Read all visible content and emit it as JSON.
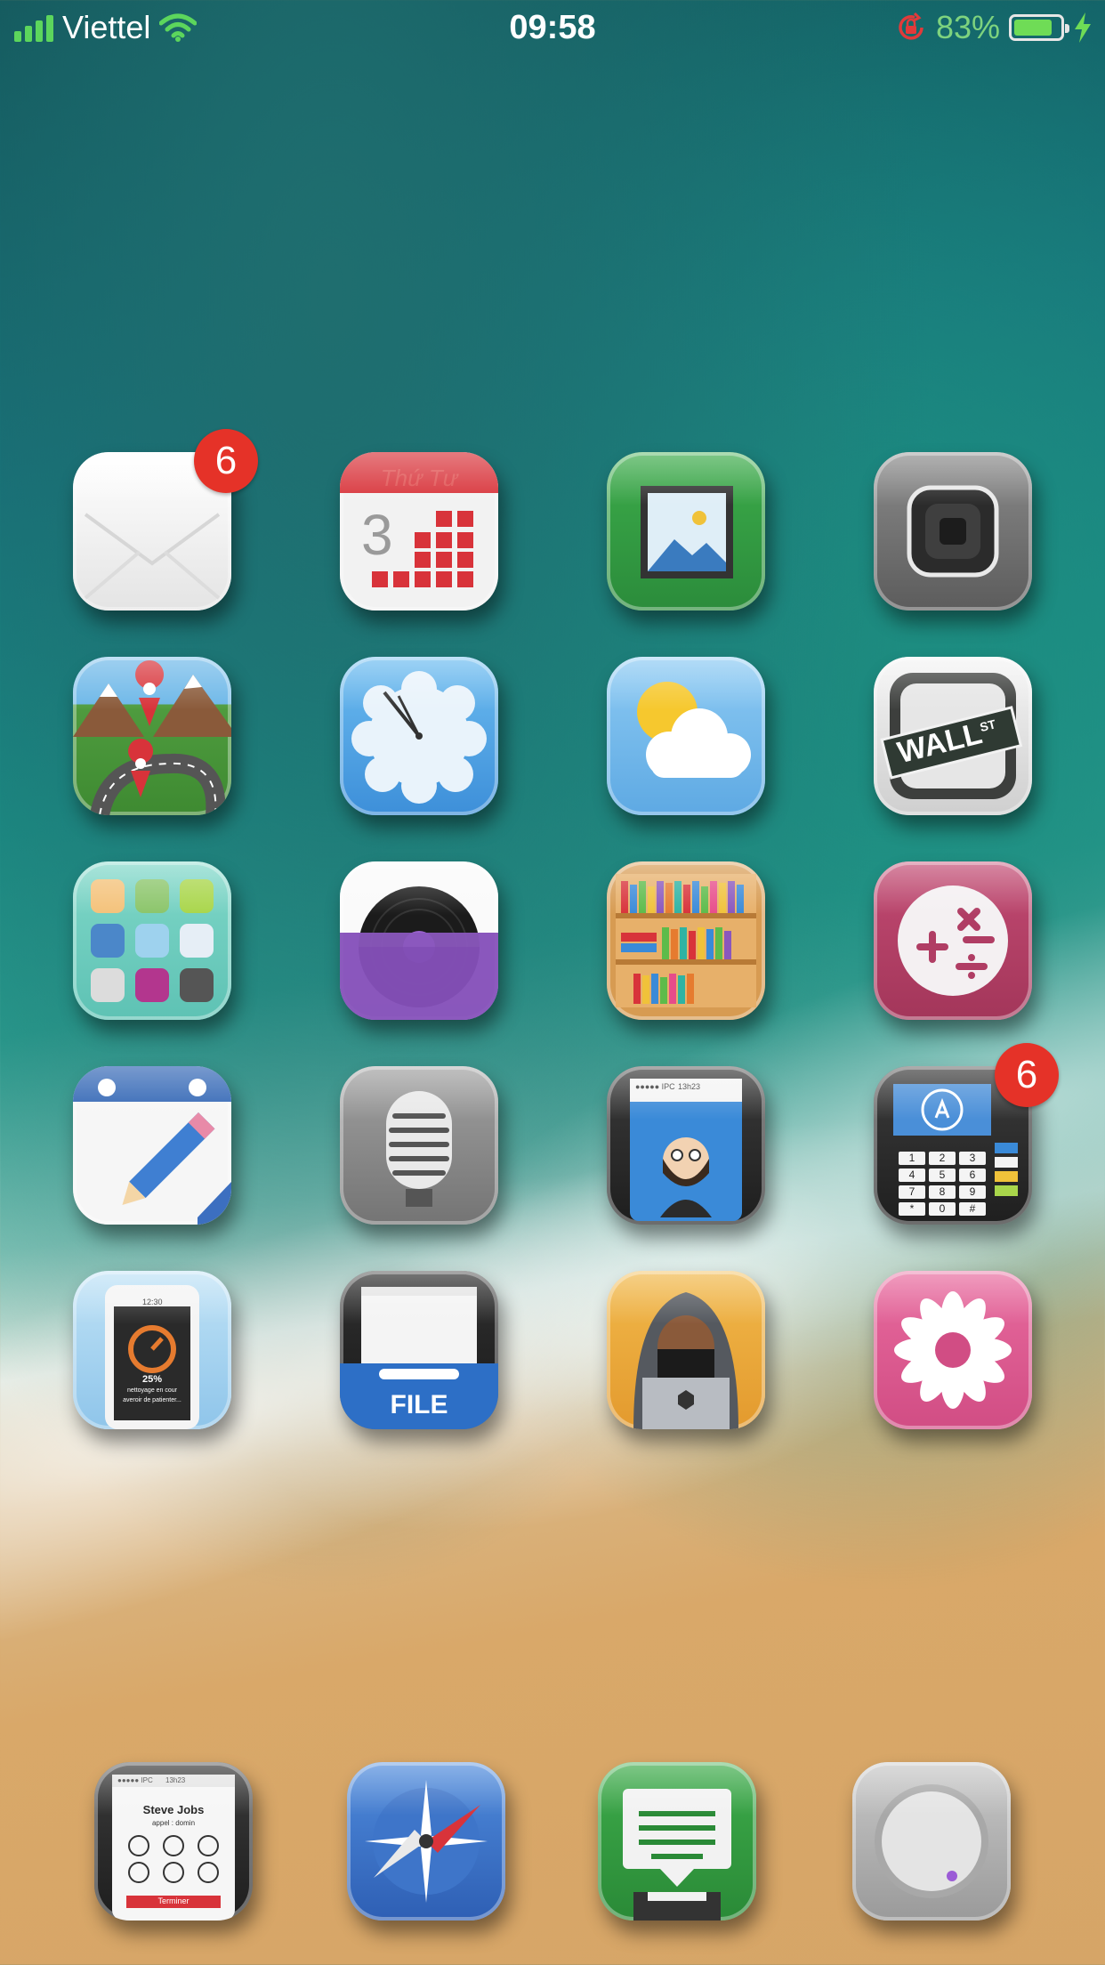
{
  "status_bar": {
    "carrier": "Viettel",
    "time": "09:58",
    "battery_percent": "83%",
    "battery_level": 0.83,
    "icons": [
      "signal-icon",
      "wifi-icon",
      "rotation-lock-icon",
      "battery-icon",
      "charging-bolt-icon"
    ]
  },
  "home_apps": [
    {
      "name": "mail",
      "icon": "envelope-icon",
      "badge": "6"
    },
    {
      "name": "calendar",
      "icon": "calendar-icon",
      "header": "Thứ Tư",
      "day": "3"
    },
    {
      "name": "photos",
      "icon": "picture-frame-icon"
    },
    {
      "name": "camera",
      "icon": "camera-lens-icon"
    },
    {
      "name": "maps",
      "icon": "map-pins-icon"
    },
    {
      "name": "clock",
      "icon": "clock-icon"
    },
    {
      "name": "weather",
      "icon": "sun-cloud-icon"
    },
    {
      "name": "stocks",
      "icon": "wall-street-sign-icon",
      "sign_text": "WALL",
      "sign_sup": "ST"
    },
    {
      "name": "app-folder",
      "icon": "folder-grid-icon"
    },
    {
      "name": "music",
      "icon": "vinyl-record-icon"
    },
    {
      "name": "books",
      "icon": "bookshelf-icon"
    },
    {
      "name": "calculator",
      "icon": "math-symbols-icon"
    },
    {
      "name": "notes",
      "icon": "notepad-pencil-icon"
    },
    {
      "name": "voice-memos",
      "icon": "microphone-icon"
    },
    {
      "name": "contacts",
      "icon": "phone-contact-icon",
      "carrier_text": "●●●●● IPC",
      "time_text": "13h23"
    },
    {
      "name": "app-store",
      "icon": "payment-terminal-icon",
      "badge": "6",
      "keys": [
        "1",
        "2",
        "3",
        "4",
        "5",
        "6",
        "7",
        "8",
        "9",
        "*",
        "0",
        "#"
      ]
    },
    {
      "name": "cleaner",
      "icon": "phone-cleaner-icon",
      "time_text": "12:30",
      "percent": "25%",
      "line1": "nettoyage en cour",
      "line2": "averoir de patienter..."
    },
    {
      "name": "files",
      "icon": "file-drawer-icon",
      "label": "FILE"
    },
    {
      "name": "hacker",
      "icon": "hooded-hacker-icon"
    },
    {
      "name": "flower",
      "icon": "flower-icon"
    }
  ],
  "dock_apps": [
    {
      "name": "phone",
      "icon": "phone-call-icon",
      "carrier_text": "●●●●● IPC",
      "time_text": "13h23",
      "caller": "Steve Jobs",
      "status": "appel : domin",
      "end_label": "Terminer"
    },
    {
      "name": "safari",
      "icon": "compass-icon"
    },
    {
      "name": "messages",
      "icon": "message-printer-icon"
    },
    {
      "name": "settings",
      "icon": "knob-icon"
    }
  ]
}
